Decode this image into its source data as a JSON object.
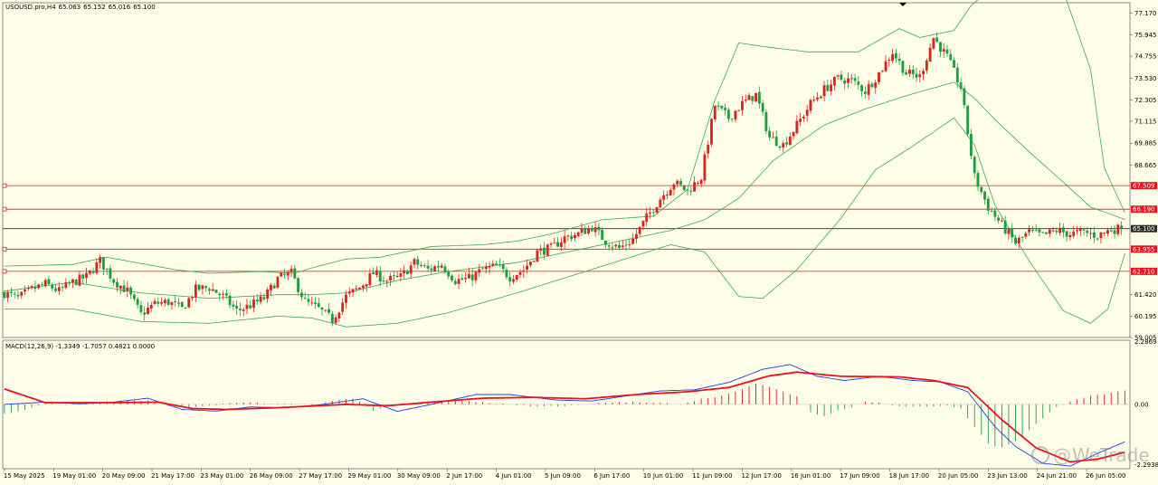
{
  "window": {
    "symbol": "USOUSD.pro,H4",
    "ohlc": [
      "65.063",
      "65.152",
      "65.016",
      "65.100"
    ]
  },
  "indicator": {
    "label": "MACD(12,26,9) -1.3349 -1.7057 0.4821 0.0000"
  },
  "watermark": {
    "at": "@",
    "text": "WeTrade"
  },
  "colors": {
    "background": "#fefee9",
    "bull_candle": "#d7261e",
    "bear_candle": "#1f9d3f",
    "bollinger": "#3aa84f",
    "hline": "#e8131b",
    "current_price_line": "#2b2b2b",
    "macd_line": "#1e3fe0",
    "signal_line": "#e8131b",
    "hist_pos": "#e8131b",
    "hist_neg": "#1f9d3f"
  },
  "chart_data": [
    {
      "type": "candlestick",
      "panel": "price",
      "title": "USOUSD.pro,H4",
      "ylim": [
        59.005,
        77.75
      ],
      "price_axis_ticks": [
        "77.170",
        "75.945",
        "74.755",
        "73.530",
        "72.305",
        "71.115",
        "69.885",
        "68.665",
        "67.509",
        "66.190",
        "65.100",
        "63.955",
        "62.710",
        "61.420",
        "60.195",
        "59.005"
      ],
      "time_axis_labels": [
        "15 May 2025",
        "19 May 01:00",
        "20 May 09:00",
        "21 May 17:00",
        "23 May 01:00",
        "26 May 09:00",
        "27 May 17:00",
        "29 May 01:00",
        "30 May 09:00",
        "2 Jun 17:00",
        "4 Jun 01:00",
        "5 Jun 09:00",
        "6 Jun 17:00",
        "10 Jun 01:00",
        "11 Jun 09:00",
        "12 Jun 17:00",
        "16 Jun 01:00",
        "17 Jun 09:00",
        "18 Jun 17:00",
        "20 Jun 05:00",
        "23 Jun 13:00",
        "24 Jun 21:00",
        "26 Jun 05:00"
      ],
      "horizontal_levels": [
        {
          "price": 67.509,
          "label": "67.509",
          "kind": "level"
        },
        {
          "price": 66.19,
          "label": "66.190",
          "kind": "level"
        },
        {
          "price": 65.1,
          "label": "65.100",
          "kind": "current"
        },
        {
          "price": 63.955,
          "label": "63.955",
          "kind": "level"
        },
        {
          "price": 62.71,
          "label": "62.710",
          "kind": "level"
        }
      ],
      "close_path": [
        [
          0,
          61.5
        ],
        [
          4,
          61.2
        ],
        [
          8,
          61.7
        ],
        [
          12,
          62.0
        ],
        [
          16,
          61.6
        ],
        [
          20,
          62.1
        ],
        [
          24,
          62.4
        ],
        [
          28,
          63.3
        ],
        [
          32,
          62.2
        ],
        [
          36,
          61.6
        ],
        [
          40,
          60.3
        ],
        [
          44,
          60.9
        ],
        [
          48,
          61.0
        ],
        [
          52,
          60.6
        ],
        [
          56,
          61.7
        ],
        [
          60,
          61.8
        ],
        [
          64,
          61.3
        ],
        [
          68,
          60.5
        ],
        [
          72,
          60.8
        ],
        [
          76,
          61.2
        ],
        [
          80,
          62.3
        ],
        [
          84,
          62.6
        ],
        [
          88,
          61.0
        ],
        [
          92,
          60.6
        ],
        [
          96,
          60.0
        ],
        [
          100,
          61.3
        ],
        [
          104,
          61.8
        ],
        [
          108,
          62.6
        ],
        [
          112,
          62.2
        ],
        [
          116,
          62.4
        ],
        [
          120,
          63.2
        ],
        [
          124,
          62.8
        ],
        [
          128,
          63.1
        ],
        [
          132,
          62.2
        ],
        [
          136,
          62.3
        ],
        [
          140,
          62.8
        ],
        [
          144,
          63.0
        ],
        [
          148,
          62.4
        ],
        [
          152,
          62.8
        ],
        [
          156,
          63.8
        ],
        [
          160,
          64.0
        ],
        [
          164,
          64.6
        ],
        [
          168,
          64.8
        ],
        [
          172,
          65.2
        ],
        [
          176,
          64.4
        ],
        [
          180,
          64.0
        ],
        [
          184,
          64.5
        ],
        [
          188,
          65.7
        ],
        [
          192,
          66.8
        ],
        [
          196,
          67.7
        ],
        [
          200,
          67.2
        ],
        [
          204,
          68.0
        ],
        [
          208,
          72.0
        ],
        [
          212,
          71.3
        ],
        [
          216,
          72.1
        ],
        [
          220,
          72.6
        ],
        [
          224,
          70.2
        ],
        [
          228,
          69.8
        ],
        [
          232,
          70.9
        ],
        [
          236,
          72.1
        ],
        [
          240,
          72.9
        ],
        [
          244,
          73.5
        ],
        [
          248,
          73.4
        ],
        [
          252,
          72.8
        ],
        [
          256,
          73.8
        ],
        [
          260,
          75.0
        ],
        [
          264,
          73.8
        ],
        [
          268,
          73.6
        ],
        [
          272,
          75.8
        ],
        [
          276,
          74.7
        ],
        [
          280,
          73.0
        ],
        [
          284,
          68.0
        ],
        [
          288,
          66.3
        ],
        [
          292,
          65.3
        ],
        [
          296,
          64.3
        ],
        [
          300,
          64.9
        ],
        [
          304,
          64.7
        ],
        [
          308,
          65.0
        ],
        [
          312,
          64.8
        ],
        [
          316,
          64.9
        ],
        [
          320,
          64.7
        ],
        [
          324,
          65.06
        ],
        [
          327,
          65.1
        ]
      ],
      "bollinger": {
        "upper": [
          [
            0,
            63.0
          ],
          [
            20,
            63.1
          ],
          [
            30,
            63.5
          ],
          [
            50,
            62.8
          ],
          [
            60,
            62.6
          ],
          [
            75,
            62.7
          ],
          [
            85,
            62.6
          ],
          [
            90,
            62.9
          ],
          [
            100,
            63.4
          ],
          [
            110,
            63.5
          ],
          [
            125,
            64.1
          ],
          [
            140,
            64.2
          ],
          [
            150,
            64.4
          ],
          [
            160,
            64.8
          ],
          [
            175,
            65.6
          ],
          [
            190,
            65.8
          ],
          [
            200,
            67.3
          ],
          [
            208,
            72.3
          ],
          [
            215,
            75.5
          ],
          [
            222,
            75.3
          ],
          [
            235,
            75.0
          ],
          [
            250,
            75.0
          ],
          [
            262,
            76.3
          ],
          [
            268,
            75.8
          ],
          [
            278,
            76.2
          ],
          [
            283,
            77.6
          ],
          [
            290,
            78.7
          ],
          [
            296,
            79.2
          ],
          [
            302,
            79.6
          ],
          [
            310,
            78.4
          ],
          [
            318,
            74.0
          ],
          [
            322,
            68.5
          ],
          [
            328,
            66.0
          ]
        ],
        "middle": [
          [
            0,
            61.6
          ],
          [
            20,
            62.1
          ],
          [
            40,
            61.5
          ],
          [
            60,
            61.2
          ],
          [
            80,
            61.4
          ],
          [
            90,
            61.4
          ],
          [
            100,
            61.5
          ],
          [
            115,
            62.2
          ],
          [
            130,
            62.7
          ],
          [
            150,
            63.2
          ],
          [
            165,
            63.8
          ],
          [
            180,
            64.4
          ],
          [
            195,
            65.0
          ],
          [
            205,
            65.6
          ],
          [
            215,
            66.8
          ],
          [
            225,
            68.9
          ],
          [
            240,
            70.9
          ],
          [
            252,
            71.8
          ],
          [
            265,
            72.6
          ],
          [
            278,
            73.3
          ],
          [
            284,
            72.4
          ],
          [
            290,
            71.2
          ],
          [
            300,
            69.4
          ],
          [
            310,
            67.7
          ],
          [
            318,
            66.3
          ],
          [
            324,
            65.9
          ],
          [
            328,
            65.6
          ]
        ],
        "lower": [
          [
            0,
            60.6
          ],
          [
            20,
            60.6
          ],
          [
            40,
            59.9
          ],
          [
            60,
            59.8
          ],
          [
            80,
            60.2
          ],
          [
            90,
            60.1
          ],
          [
            100,
            59.6
          ],
          [
            115,
            59.8
          ],
          [
            130,
            60.4
          ],
          [
            150,
            61.5
          ],
          [
            165,
            62.4
          ],
          [
            180,
            63.3
          ],
          [
            195,
            64.2
          ],
          [
            205,
            63.8
          ],
          [
            215,
            61.3
          ],
          [
            222,
            61.2
          ],
          [
            232,
            62.8
          ],
          [
            245,
            65.7
          ],
          [
            255,
            68.4
          ],
          [
            265,
            69.6
          ],
          [
            278,
            71.3
          ],
          [
            284,
            69.8
          ],
          [
            290,
            66.4
          ],
          [
            300,
            63.3
          ],
          [
            310,
            60.5
          ],
          [
            318,
            59.8
          ],
          [
            323,
            60.6
          ],
          [
            328,
            63.7
          ]
        ]
      }
    },
    {
      "type": "macd",
      "panel": "indicator",
      "title": "MACD(12,26,9)",
      "params": [
        12,
        26,
        9
      ],
      "readout": {
        "macd": -1.3349,
        "signal": -1.7057,
        "histogram": 0.4821,
        "level": 0.0
      },
      "ylim": [
        -2.2938,
        2.2869
      ],
      "axis_ticks": [
        "2.2869",
        "0.00",
        "-2.2938"
      ],
      "macd_line": [
        [
          0,
          0.0
        ],
        [
          12,
          0.08
        ],
        [
          22,
          0.02
        ],
        [
          32,
          0.08
        ],
        [
          42,
          0.22
        ],
        [
          52,
          -0.18
        ],
        [
          62,
          -0.24
        ],
        [
          72,
          -0.09
        ],
        [
          82,
          -0.12
        ],
        [
          92,
          -0.02
        ],
        [
          105,
          0.2
        ],
        [
          115,
          -0.25
        ],
        [
          125,
          0.0
        ],
        [
          138,
          0.35
        ],
        [
          148,
          0.35
        ],
        [
          162,
          0.15
        ],
        [
          172,
          0.12
        ],
        [
          182,
          0.3
        ],
        [
          192,
          0.48
        ],
        [
          202,
          0.52
        ],
        [
          212,
          0.78
        ],
        [
          222,
          1.25
        ],
        [
          230,
          1.42
        ],
        [
          238,
          1.0
        ],
        [
          246,
          0.85
        ],
        [
          256,
          1.0
        ],
        [
          266,
          0.85
        ],
        [
          274,
          0.8
        ],
        [
          282,
          0.45
        ],
        [
          290,
          -0.8
        ],
        [
          296,
          -1.5
        ],
        [
          304,
          -2.1
        ],
        [
          312,
          -2.2
        ],
        [
          320,
          -1.75
        ],
        [
          328,
          -1.33
        ]
      ],
      "signal_line": [
        [
          0,
          0.55
        ],
        [
          12,
          0.06
        ],
        [
          32,
          0.06
        ],
        [
          45,
          0.08
        ],
        [
          55,
          -0.15
        ],
        [
          65,
          -0.18
        ],
        [
          80,
          -0.12
        ],
        [
          100,
          0.0
        ],
        [
          112,
          -0.05
        ],
        [
          125,
          0.08
        ],
        [
          140,
          0.22
        ],
        [
          155,
          0.25
        ],
        [
          170,
          0.2
        ],
        [
          185,
          0.35
        ],
        [
          200,
          0.45
        ],
        [
          212,
          0.6
        ],
        [
          224,
          1.02
        ],
        [
          232,
          1.15
        ],
        [
          245,
          1.0
        ],
        [
          262,
          0.98
        ],
        [
          272,
          0.85
        ],
        [
          282,
          0.6
        ],
        [
          292,
          -0.55
        ],
        [
          302,
          -1.55
        ],
        [
          312,
          -2.05
        ],
        [
          320,
          -1.95
        ],
        [
          328,
          -1.71
        ]
      ],
      "histogram": [
        [
          0,
          -0.35
        ],
        [
          6,
          -0.2
        ],
        [
          12,
          0.05
        ],
        [
          18,
          0.0
        ],
        [
          24,
          0.04
        ],
        [
          30,
          0.09
        ],
        [
          36,
          0.12
        ],
        [
          42,
          0.15
        ],
        [
          48,
          -0.08
        ],
        [
          54,
          -0.1
        ],
        [
          60,
          -0.06
        ],
        [
          66,
          0.05
        ],
        [
          72,
          0.08
        ],
        [
          78,
          0.02
        ],
        [
          84,
          0.04
        ],
        [
          90,
          -0.04
        ],
        [
          96,
          0.12
        ],
        [
          102,
          0.22
        ],
        [
          108,
          -0.22
        ],
        [
          114,
          -0.05
        ],
        [
          120,
          0.04
        ],
        [
          126,
          0.1
        ],
        [
          132,
          0.15
        ],
        [
          138,
          0.1
        ],
        [
          144,
          0.04
        ],
        [
          150,
          -0.05
        ],
        [
          156,
          -0.08
        ],
        [
          162,
          -0.06
        ],
        [
          168,
          -0.04
        ],
        [
          174,
          0.05
        ],
        [
          180,
          0.08
        ],
        [
          186,
          0.08
        ],
        [
          192,
          0.07
        ],
        [
          198,
          -0.02
        ],
        [
          204,
          0.2
        ],
        [
          210,
          0.3
        ],
        [
          216,
          0.55
        ],
        [
          220,
          0.75
        ],
        [
          224,
          0.62
        ],
        [
          228,
          0.45
        ],
        [
          232,
          0.3
        ],
        [
          236,
          -0.28
        ],
        [
          240,
          -0.4
        ],
        [
          244,
          -0.22
        ],
        [
          248,
          -0.1
        ],
        [
          252,
          0.1
        ],
        [
          256,
          0.08
        ],
        [
          260,
          -0.05
        ],
        [
          264,
          -0.1
        ],
        [
          268,
          -0.08
        ],
        [
          272,
          -0.06
        ],
        [
          276,
          -0.03
        ],
        [
          280,
          -0.15
        ],
        [
          284,
          -0.8
        ],
        [
          288,
          -1.4
        ],
        [
          292,
          -1.55
        ],
        [
          296,
          -1.3
        ],
        [
          300,
          -0.9
        ],
        [
          304,
          -0.5
        ],
        [
          308,
          -0.1
        ],
        [
          312,
          0.12
        ],
        [
          316,
          0.25
        ],
        [
          320,
          0.33
        ],
        [
          324,
          0.4
        ],
        [
          328,
          0.48
        ]
      ]
    }
  ]
}
